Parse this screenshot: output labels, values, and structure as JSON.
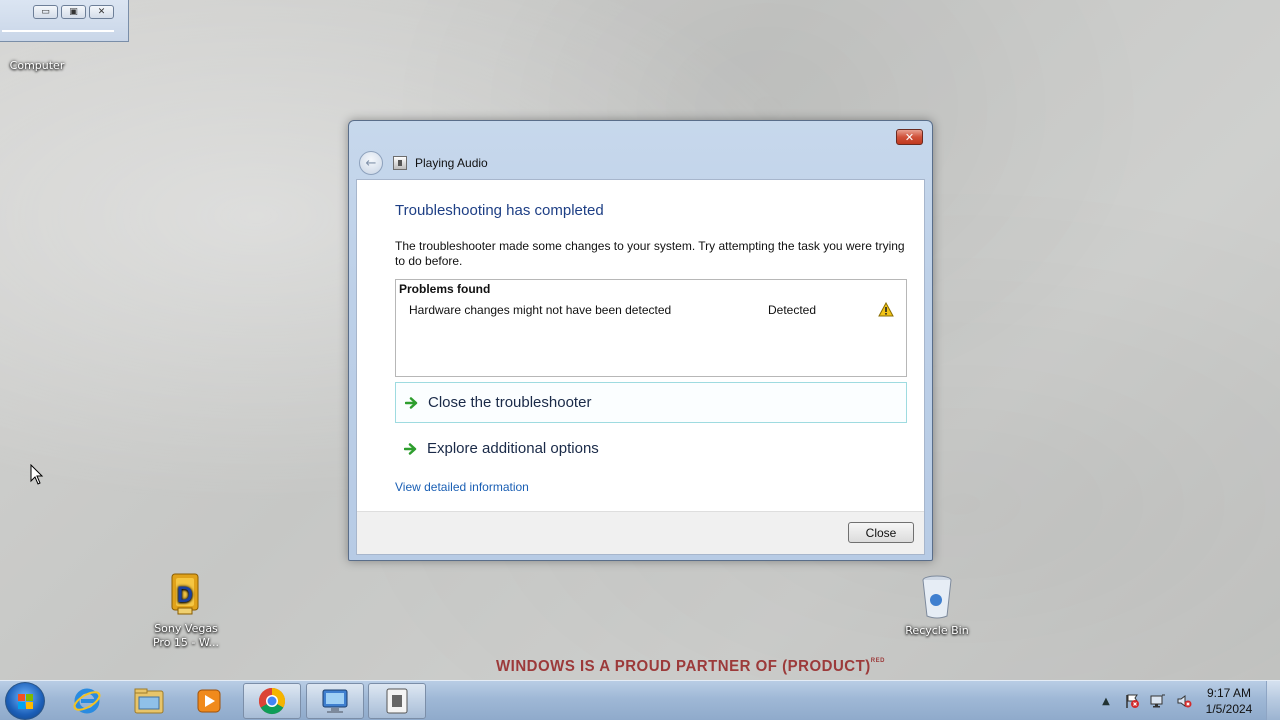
{
  "desktop": {
    "icons": {
      "computer": "Computer",
      "vegas_line1": "Sony Vegas",
      "vegas_line2": "Pro 15 - W...",
      "recycle_bin": "Recycle Bin"
    },
    "watermark": {
      "text": "WINDOWS IS A PROUD PARTNER OF (PRODUCT)",
      "sup": "RED"
    }
  },
  "dialog": {
    "title": "Playing Audio",
    "heading": "Troubleshooting has completed",
    "description": "The troubleshooter made some changes to your system. Try attempting the task you were trying to do before.",
    "problems_header": "Problems found",
    "problems": [
      {
        "name": "Hardware changes might not have been detected",
        "status": "Detected",
        "icon": "warning-icon"
      }
    ],
    "options": [
      {
        "label": "Close the troubleshooter",
        "icon": "green-arrow-icon"
      },
      {
        "label": "Explore additional options",
        "icon": "green-arrow-icon"
      }
    ],
    "detail_link": "View detailed information",
    "close_button": "Close",
    "close_x": "✕"
  },
  "taskbar": {
    "pinned": [
      "internet-explorer-icon",
      "windows-explorer-icon",
      "media-player-icon",
      "chrome-icon",
      "remote-desktop-icon",
      "troubleshooter-icon"
    ],
    "clock": {
      "time": "9:17 AM",
      "date": "1/5/2024"
    }
  },
  "colors": {
    "heading": "#1e3f85",
    "link": "#1a5fb4",
    "close_red": "#c0391f",
    "arrow_green": "#2e9e2e",
    "taskbar": "#9fb8d6"
  }
}
